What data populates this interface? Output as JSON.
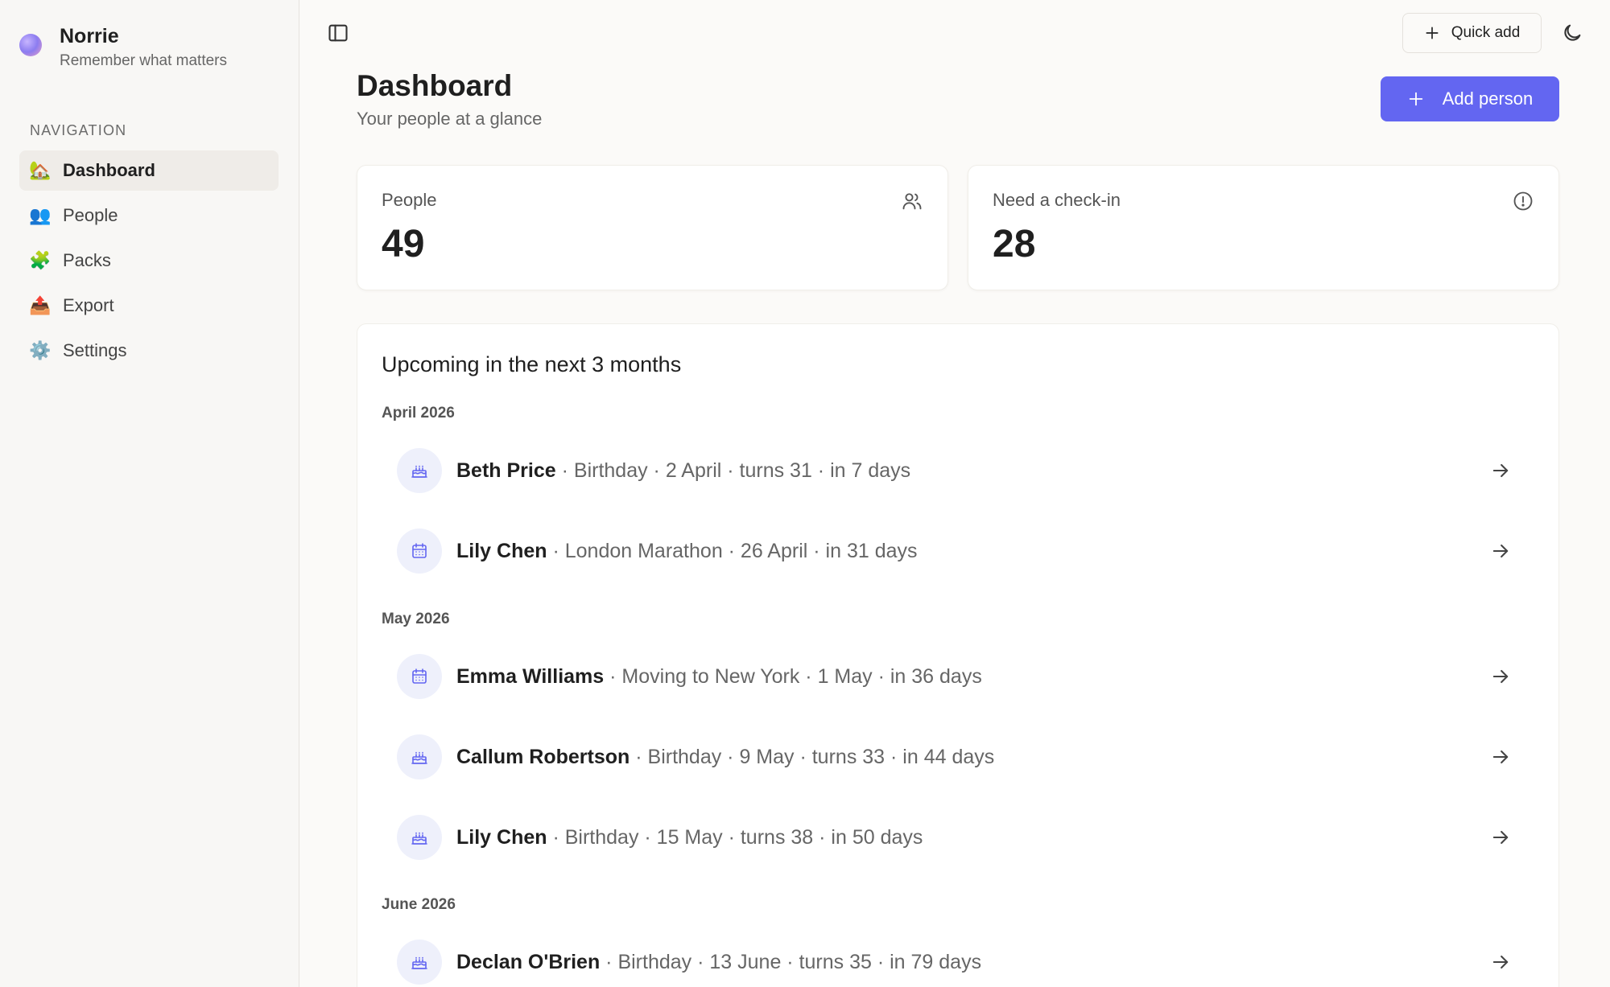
{
  "brand": {
    "name": "Norrie",
    "tagline": "Remember what matters"
  },
  "sidebar": {
    "heading": "NAVIGATION",
    "items": [
      {
        "label": "Dashboard",
        "icon": "🏡",
        "active": true
      },
      {
        "label": "People",
        "icon": "👥",
        "active": false
      },
      {
        "label": "Packs",
        "icon": "🧩",
        "active": false
      },
      {
        "label": "Export",
        "icon": "📤",
        "active": false
      },
      {
        "label": "Settings",
        "icon": "⚙️",
        "active": false
      }
    ]
  },
  "topbar": {
    "quick_add_label": "Quick add"
  },
  "header": {
    "title": "Dashboard",
    "subtitle": "Your people at a glance",
    "add_person_label": "Add person"
  },
  "stats": {
    "people": {
      "label": "People",
      "value": "49"
    },
    "checkin": {
      "label": "Need a check-in",
      "value": "28"
    }
  },
  "upcoming": {
    "title": "Upcoming in the next 3 months",
    "months": {
      "april": "April 2026",
      "may": "May 2026",
      "june": "June 2026"
    },
    "events": [
      {
        "name": "Beth Price",
        "details": " · Birthday · 2 April · turns 31 · in 7 days",
        "type": "birthday"
      },
      {
        "name": "Lily Chen",
        "details": " · London Marathon · 26 April · in 31 days",
        "type": "event"
      },
      {
        "name": "Emma Williams",
        "details": " · Moving to New York · 1 May · in 36 days",
        "type": "event"
      },
      {
        "name": "Callum Robertson",
        "details": " · Birthday · 9 May · turns 33 · in 44 days",
        "type": "birthday"
      },
      {
        "name": "Lily Chen",
        "details": " · Birthday · 15 May · turns 38 · in 50 days",
        "type": "birthday"
      },
      {
        "name": "Declan O'Brien",
        "details": " · Birthday · 13 June · turns 35 · in 79 days",
        "type": "birthday"
      }
    ]
  },
  "colors": {
    "accent": "#6366f1",
    "icon_bg": "#eef0fb",
    "icon_fg": "#6366f1"
  }
}
